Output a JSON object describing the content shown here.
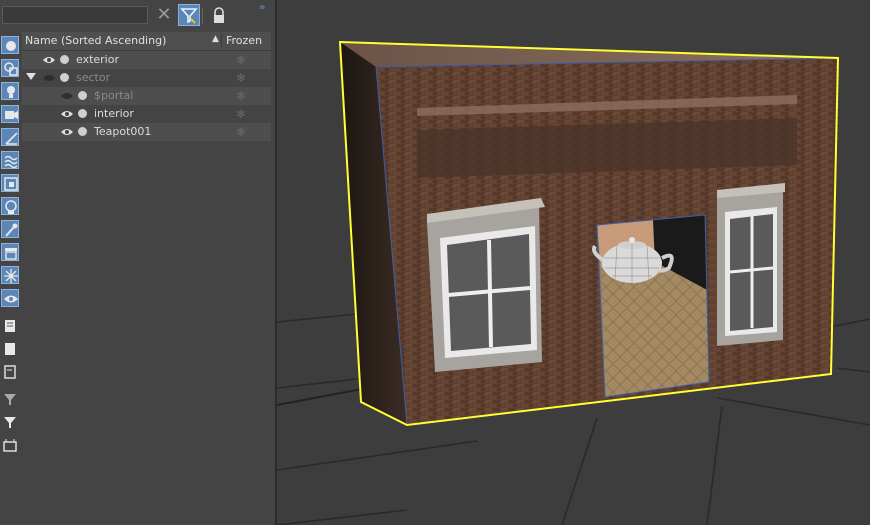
{
  "search": {
    "value": "",
    "placeholder": ""
  },
  "toolbar": {
    "clear_glyph": "✕",
    "expand_glyph": "»"
  },
  "columns": {
    "name": "Name (Sorted Ascending)",
    "sort_glyph": "▲",
    "frozen": "Frozen"
  },
  "tree": [
    {
      "label": "exterior",
      "indent": 0,
      "visible": true,
      "dim": false
    },
    {
      "label": "sector",
      "indent": 0,
      "visible": false,
      "dim": true,
      "expanded": true
    },
    {
      "label": "$portal",
      "indent": 1,
      "visible": false,
      "dim": true
    },
    {
      "label": "interior",
      "indent": 1,
      "visible": true,
      "dim": false
    },
    {
      "label": "Teapot001",
      "indent": 1,
      "visible": true,
      "dim": false
    }
  ],
  "frozen_glyph": "❄",
  "left_tools": [
    "geometry-filter-icon",
    "shapes-filter-icon",
    "lights-filter-icon",
    "cameras-filter-icon",
    "helpers-filter-icon",
    "spacewarps-filter-icon",
    "groups-filter-icon",
    "xrefs-filter-icon",
    "bones-filter-icon",
    "containers-filter-icon",
    "frozen-filter-icon",
    "hidden-filter-icon",
    "display-all-icon",
    "display-none-icon",
    "invert-display-icon",
    "filter-dropdown-icon",
    "filter-icon",
    "layer-icon"
  ],
  "colors": {
    "accent": "#5b86b8",
    "selection": "#ffff33",
    "panel": "#444444",
    "viewport": "#3d3d3d"
  }
}
